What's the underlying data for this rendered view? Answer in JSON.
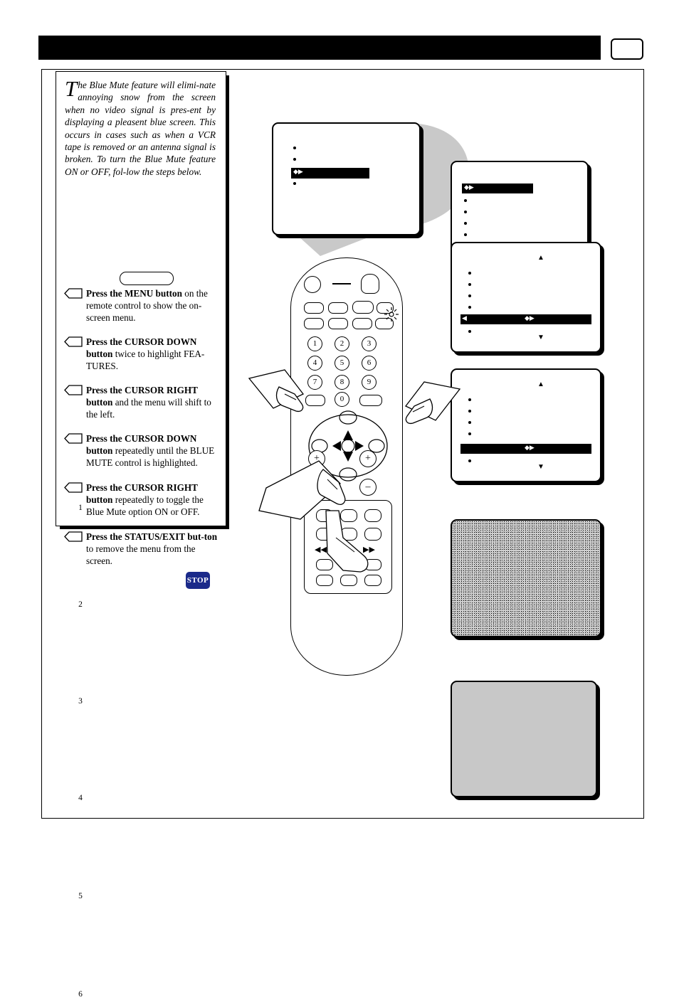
{
  "header": {
    "bar_label": "",
    "page_number_box": ""
  },
  "intro": {
    "dropcap": "T",
    "text": "he Blue Mute feature will elimi-nate annoying snow from the screen when no video signal is pres-ent by displaying a pleasent blue screen. This occurs in cases such as when a VCR tape is removed or an antenna signal is broken. To turn the Blue Mute feature ON or OFF, fol-low the steps below."
  },
  "steps": [
    {
      "number": "1",
      "bold": "Press the MENU button",
      "rest": " on the remote control to show the on-screen menu."
    },
    {
      "number": "2",
      "bold": "Press the CURSOR DOWN button",
      "rest": " twice to highlight FEA-TURES."
    },
    {
      "number": "3",
      "bold": "Press the CURSOR RIGHT button",
      "rest": " and the menu will shift to the left."
    },
    {
      "number": "4",
      "bold": "Press the CURSOR DOWN button",
      "rest": " repeatedly until the BLUE MUTE control is highlighted."
    },
    {
      "number": "5",
      "bold": "Press the CURSOR RIGHT button",
      "rest": " repeatedly to toggle the Blue Mute option ON or OFF."
    },
    {
      "number": "6",
      "bold": "Press the STATUS/EXIT but-ton",
      "rest": " to remove the menu from the screen."
    }
  ],
  "stop_badge": "STOP",
  "remote": {
    "keys": [
      "1",
      "2",
      "3",
      "4",
      "5",
      "6",
      "7",
      "8",
      "9",
      "0"
    ]
  },
  "screens": {
    "menu1": {
      "name": "main-menu-screen",
      "highlight_row": 3
    },
    "menu2": {
      "name": "features-menu-screen",
      "highlight_row": 1
    },
    "menu3": {
      "name": "features-submenu-screen",
      "highlight_row": 5
    },
    "menu4": {
      "name": "blue-mute-highlight-screen",
      "highlight_row": 6
    },
    "noise": {
      "name": "snow-screen"
    },
    "blue": {
      "name": "blue-mute-screen"
    }
  },
  "colors": {
    "highlight": "#000000",
    "blue_screen": "#c8c8c8",
    "stop_badge": "#1b2a8a"
  }
}
